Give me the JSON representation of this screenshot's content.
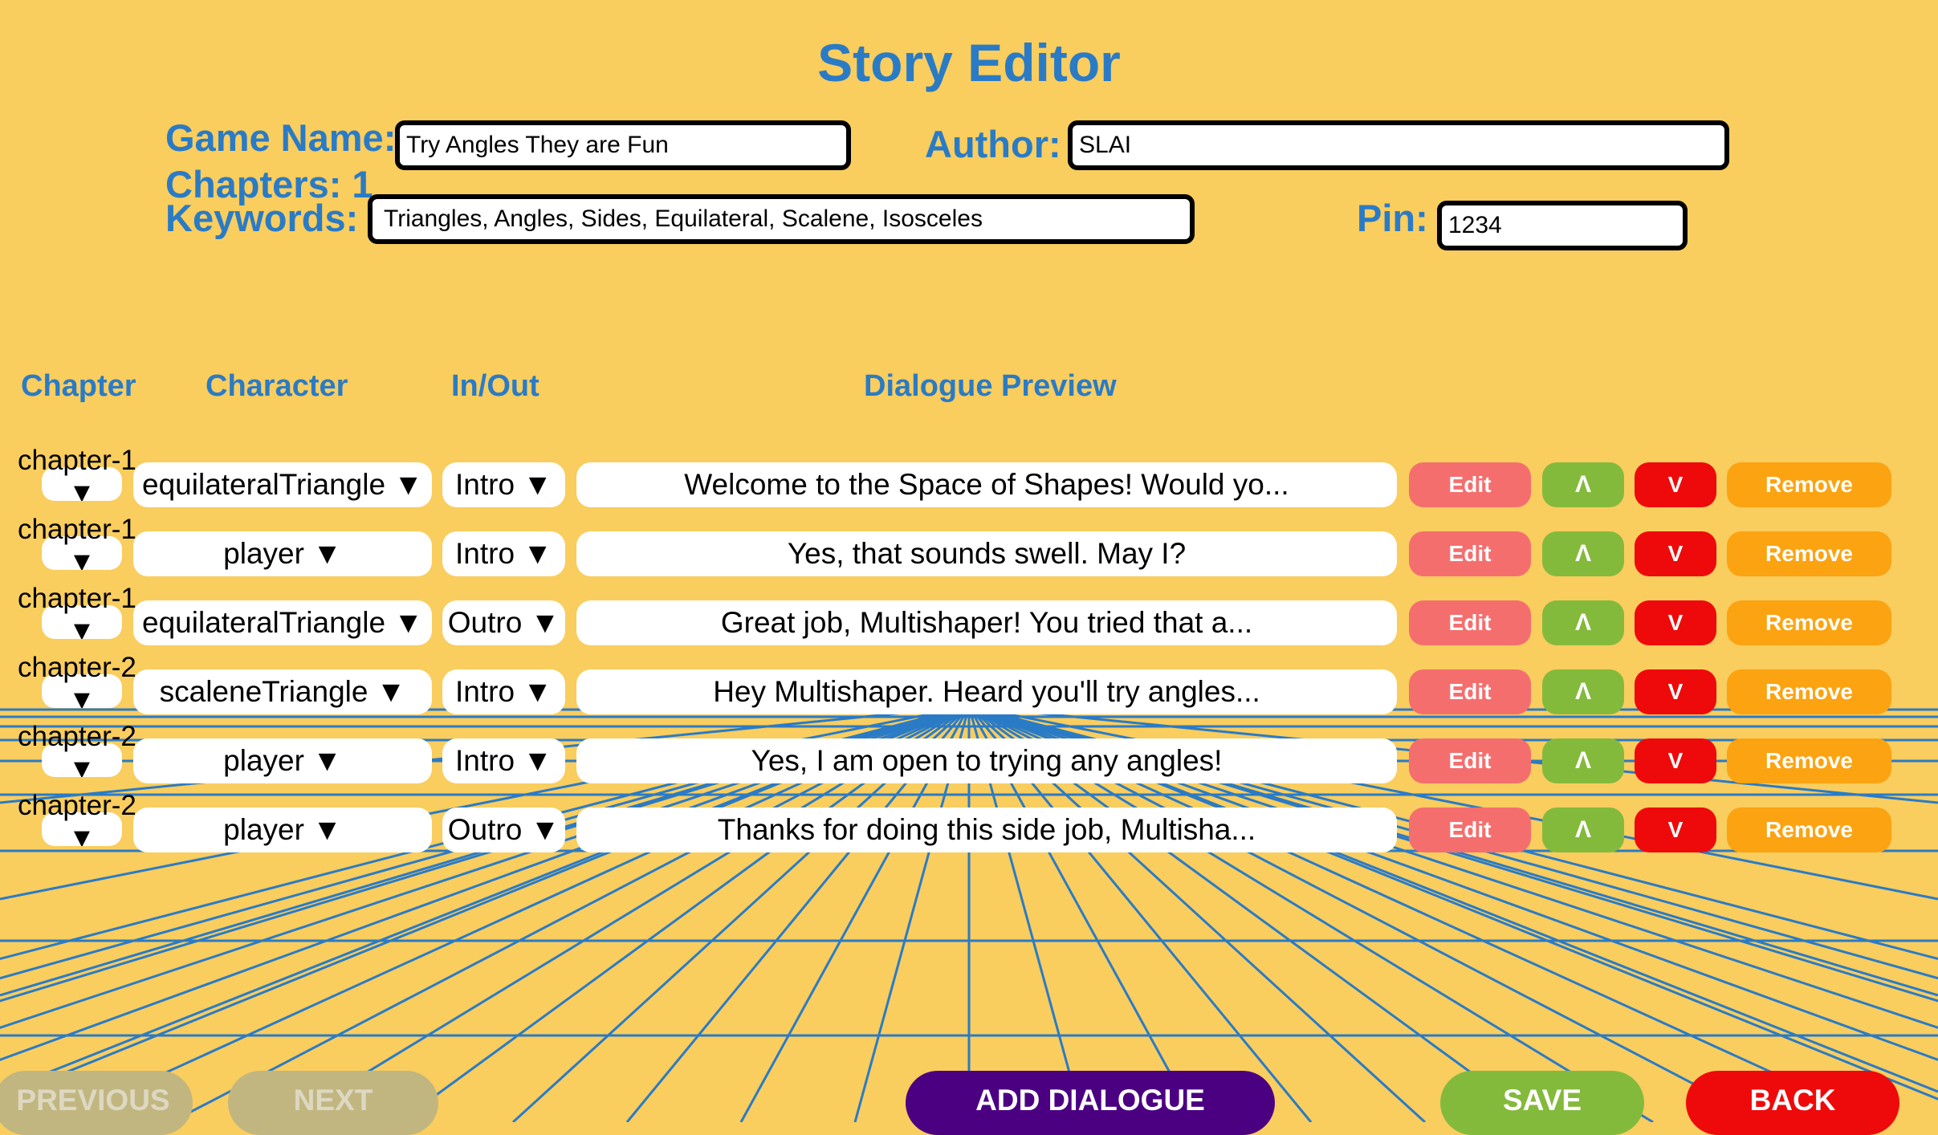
{
  "header": {
    "title": "Story Editor",
    "game_name_label": "Game Name:",
    "game_name_value": "Try Angles They are Fun",
    "author_label": "Author:",
    "author_value": "SLAI",
    "chapters_label": "Chapters: 1",
    "keywords_label": "Keywords:",
    "keywords_value": "Triangles, Angles, Sides, Equilateral, Scalene, Isosceles",
    "pin_label": "Pin:",
    "pin_value": "1234"
  },
  "columns": {
    "chapter": "Chapter",
    "character": "Character",
    "inout": "In/Out",
    "dialogue": "Dialogue Preview"
  },
  "rows": [
    {
      "chapter": "chapter-1",
      "character": "equilateralTriangle ▼",
      "inout": "Intro ▼",
      "dialogue": "Welcome to the Space of Shapes! Would yo..."
    },
    {
      "chapter": "chapter-1",
      "character": "player ▼",
      "inout": "Intro ▼",
      "dialogue": "Yes, that sounds swell. May I?"
    },
    {
      "chapter": "chapter-1",
      "character": "equilateralTriangle ▼",
      "inout": "Outro ▼",
      "dialogue": "Great job, Multishaper! You tried that a..."
    },
    {
      "chapter": "chapter-2",
      "character": "scaleneTriangle ▼",
      "inout": "Intro ▼",
      "dialogue": "Hey Multishaper. Heard you'll try angles..."
    },
    {
      "chapter": "chapter-2",
      "character": "player ▼",
      "inout": "Intro ▼",
      "dialogue": "Yes, I am open to trying any angles!"
    },
    {
      "chapter": "chapter-2",
      "character": "player ▼",
      "inout": "Outro ▼",
      "dialogue": "Thanks for doing this side job, Multisha..."
    }
  ],
  "row_buttons": {
    "chapter_arrow": "▼",
    "edit": "Edit",
    "up": "Λ",
    "down": "V",
    "remove": "Remove"
  },
  "footer": {
    "previous": "PREVIOUS",
    "next": "NEXT",
    "add_dialogue": "ADD DIALOGUE",
    "save": "SAVE",
    "back": "BACK"
  },
  "colors": {
    "background": "#f9cd5e",
    "heading": "#2a7bc6",
    "edit": "#f56e6e",
    "up": "#84ba3c",
    "down": "#ee0a0a",
    "remove": "#fca312",
    "add_dialogue": "#4b0082",
    "save": "#84ba3c",
    "back": "#ee0a0a",
    "disabled": "#c2b680"
  }
}
